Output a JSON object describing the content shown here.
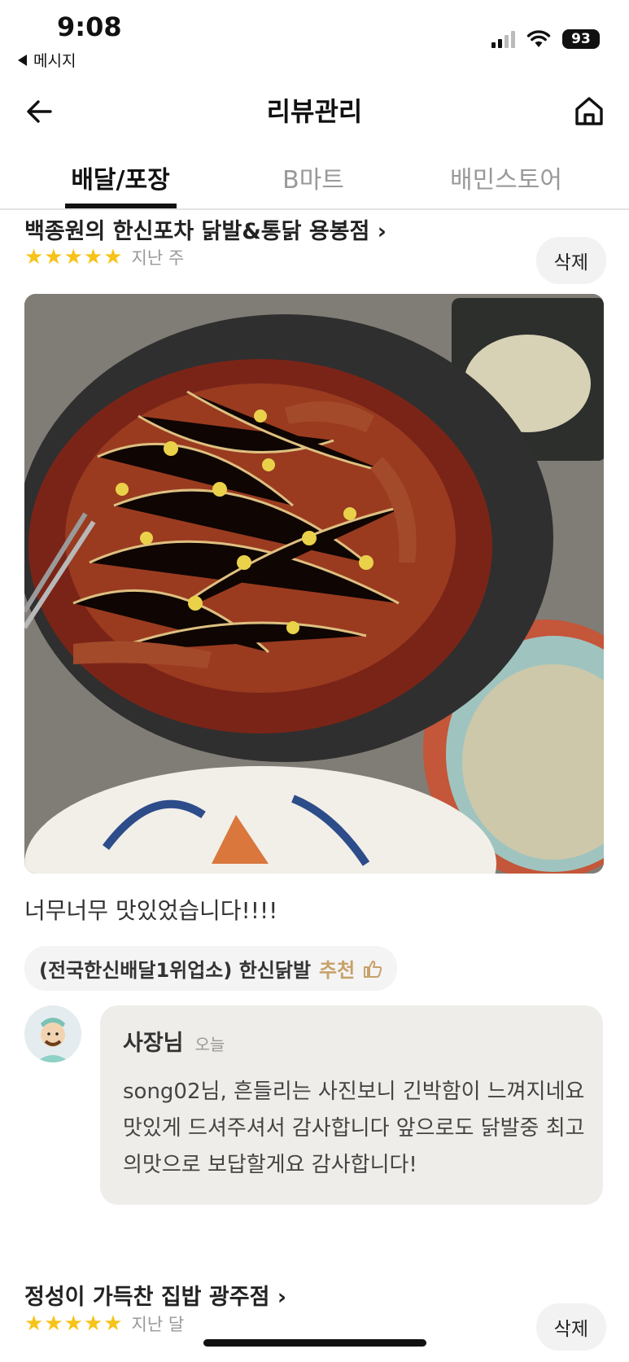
{
  "status_bar": {
    "time": "9:08",
    "back_app": "메시지",
    "battery": "93"
  },
  "nav": {
    "title": "리뷰관리",
    "back_icon": "arrow-left-icon",
    "home_icon": "home-icon"
  },
  "tabs": [
    {
      "label": "배달/포장",
      "active": true
    },
    {
      "label": "B마트",
      "active": false
    },
    {
      "label": "배민스토어",
      "active": false
    }
  ],
  "reviews": [
    {
      "store": "백종원의 한신포차 닭발&통닭 용봉점",
      "rating": 5,
      "stars": "★★★★★",
      "date": "지난 주",
      "delete_label": "삭제",
      "text": "너무너무 맛있었습니다!!!!",
      "menu": "(전국한신배달1위업소) 한신닭발",
      "recommend_label": "추천",
      "reply": {
        "author": "사장님",
        "when": "오늘",
        "body": "song02님, 흔들리는 사진보니 긴박함이 느껴지네요 맛있게 드셔주셔서 감사합니다 앞으로도 닭발중 최고의맛으로 보답할게요 감사합니다!"
      }
    },
    {
      "store": "정성이 가득찬 집밥 광주점",
      "rating": 5,
      "stars": "★★★★★",
      "date": "지난 달",
      "delete_label": "삭제"
    }
  ],
  "colors": {
    "star": "#f7c318",
    "recommend": "#c7a16a",
    "reply_bg": "#efede9"
  }
}
